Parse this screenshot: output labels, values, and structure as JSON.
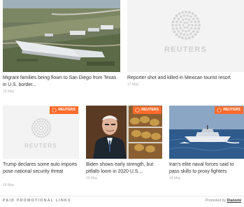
{
  "cards": [
    {
      "title": "Migrant families being flown to San Diego from Texas in U.S. border...",
      "date": "10 May"
    },
    {
      "title": "Reporter shot and killed in Mexican tourist resort",
      "date": "17 May",
      "logo_text": "REUTERS"
    },
    {
      "title": "Trump declares some auto imports pose national security threat",
      "date": "18 May",
      "logo_text": "REUTERS",
      "badge": "REUTERS"
    },
    {
      "title": "Biden shows early strength, but pitfalls loom in 2020 U.S....",
      "date": "18 May",
      "badge": "REUTERS"
    },
    {
      "title": "Iran's elite naval forces said to pass skills to proxy fighters",
      "date": "18 May",
      "badge": "REUTERS"
    }
  ],
  "footer": {
    "paid_label": "PAID PROMOTIONAL LINKS",
    "promoted_by": "Promoted by",
    "promoter": "Dianomi"
  },
  "colors": {
    "badge": "#ff6b2b",
    "placeholder_bg": "#f3f3f3"
  }
}
